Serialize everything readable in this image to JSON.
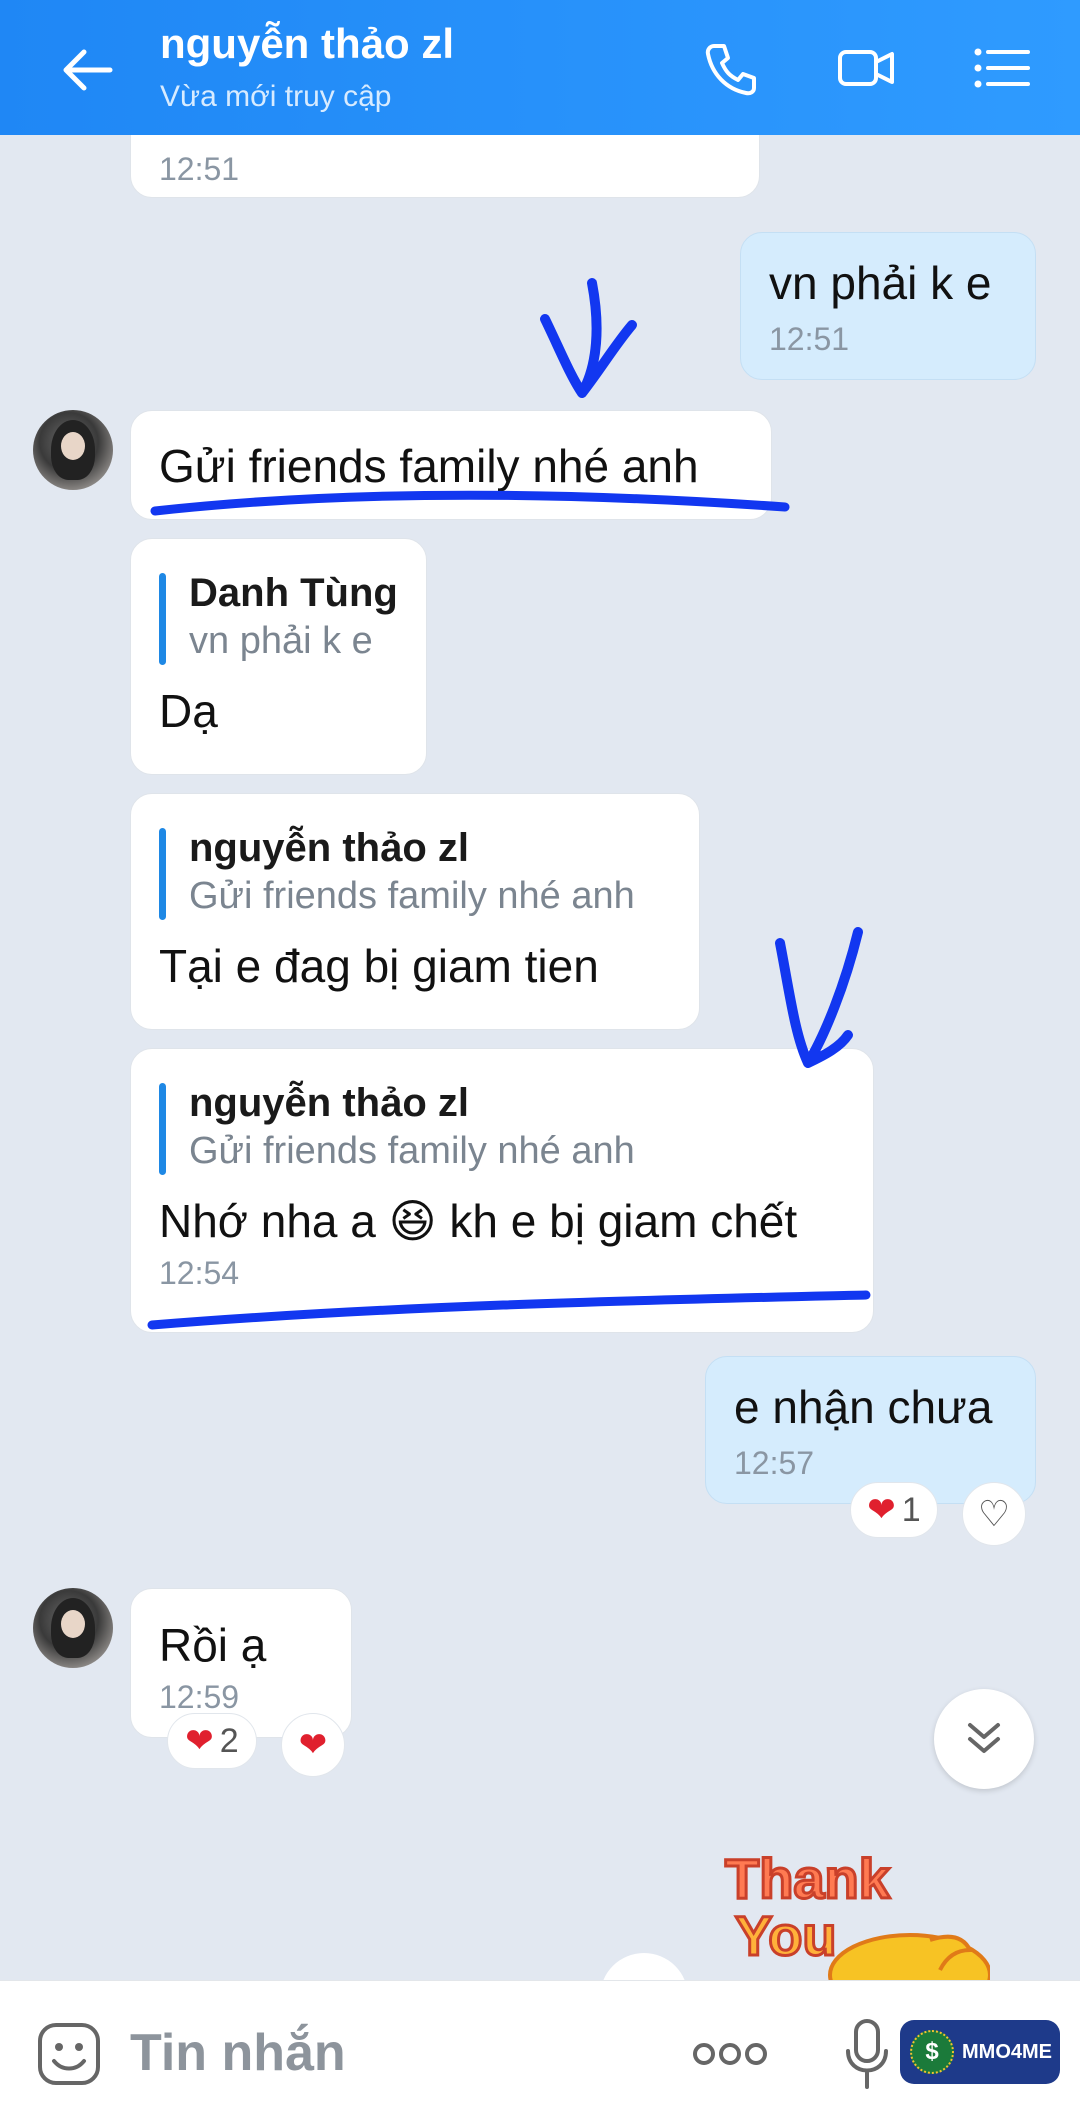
{
  "header": {
    "contact_name": "nguyễn thảo zl",
    "status": "Vừa mới truy cập",
    "icons": [
      "back-arrow-icon",
      "phone-icon",
      "video-call-icon",
      "menu-list-icon"
    ]
  },
  "messages": {
    "m0": {
      "time": "12:51"
    },
    "m1": {
      "text": "vn phải k e",
      "time": "12:51"
    },
    "m2": {
      "text": "Gửi friends family nhé anh"
    },
    "m3": {
      "quote_name": "Danh Tùng",
      "quote_text": "vn phải k e",
      "text": "Dạ"
    },
    "m4": {
      "quote_name": "nguyễn thảo zl",
      "quote_text": "Gửi friends family nhé anh",
      "text": "Tại e đag bị giam tien"
    },
    "m5": {
      "quote_name": "nguyễn thảo zl",
      "quote_text": "Gửi friends family nhé anh",
      "text_before": "Nhớ nha a",
      "emoji": "😆",
      "text_after": "kh e bị giam chết",
      "time": "12:54"
    },
    "m6": {
      "text": "e nhận chưa",
      "time": "12:57",
      "reaction_count": "1"
    },
    "m7": {
      "text": "Rồi ạ",
      "time": "12:59",
      "reaction_count": "2"
    }
  },
  "sticker": {
    "line1": "Thank",
    "line2": "You"
  },
  "input": {
    "placeholder": "Tin nhắn"
  },
  "watermark": {
    "text": "MMO4ME",
    "coin": "$"
  },
  "colors": {
    "header": "#1f87f5",
    "my_bubble": "#d5ecfd",
    "background": "#e2e8f1",
    "quote_bar": "#1e88e5",
    "heart": "#e0202e",
    "annotation": "#1237f0"
  }
}
